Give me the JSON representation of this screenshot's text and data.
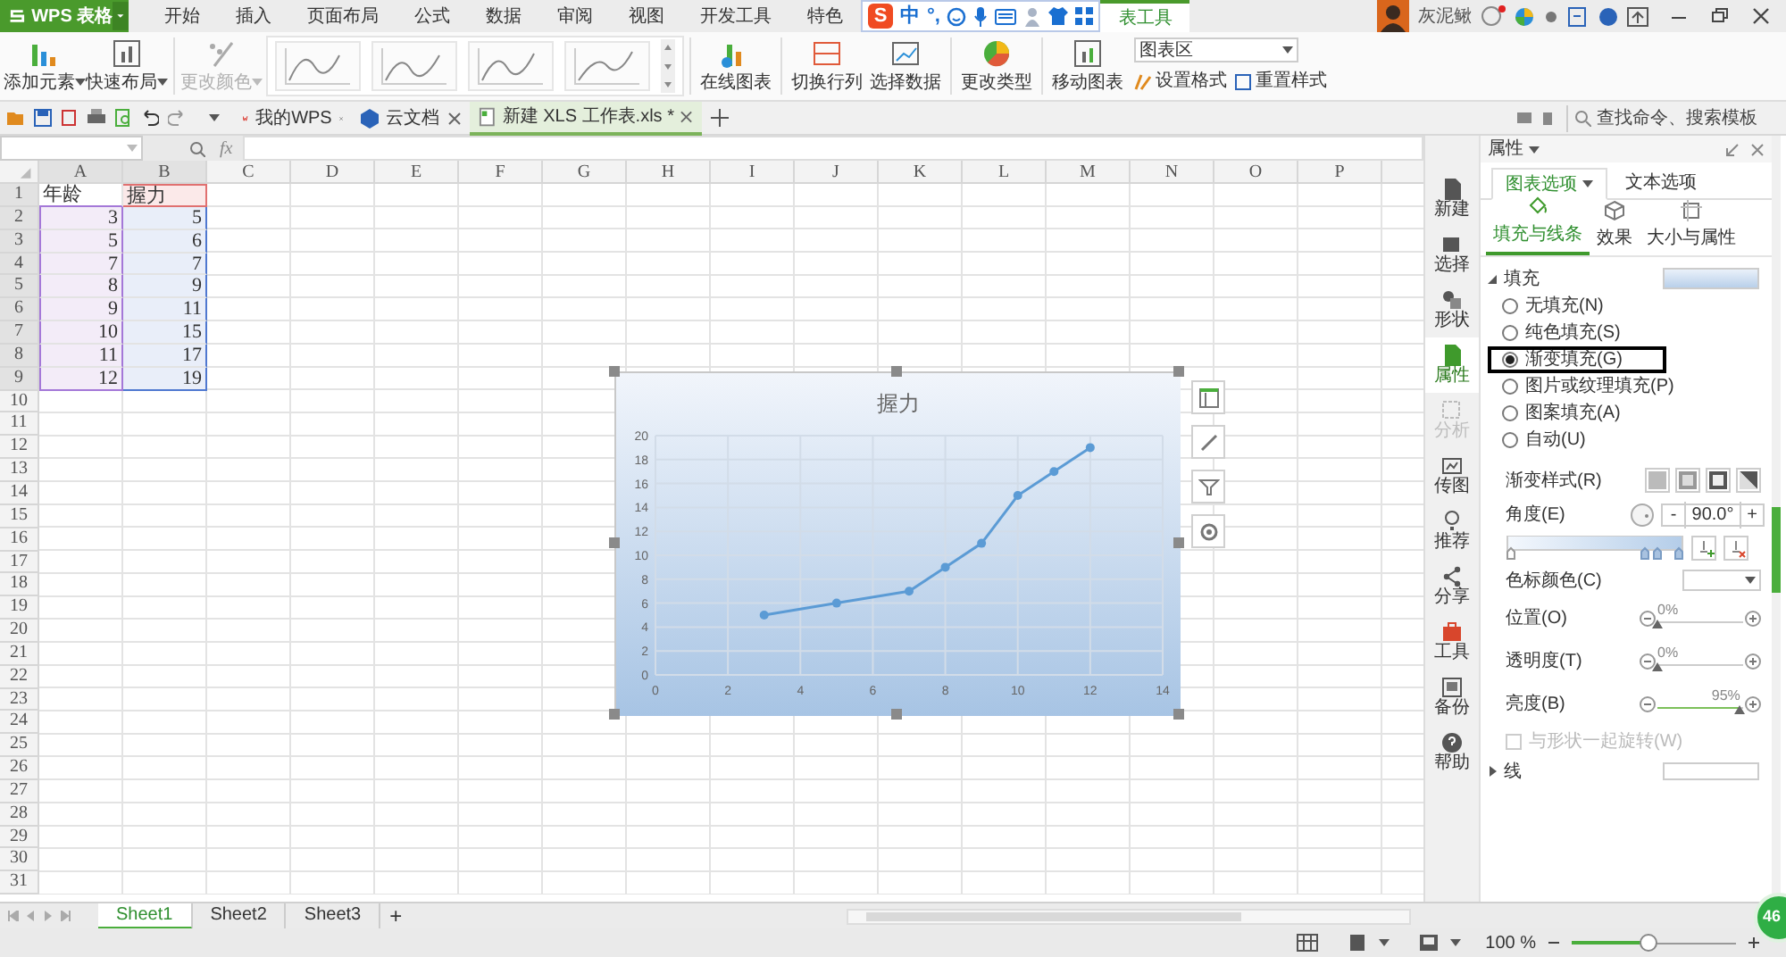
{
  "app_button": {
    "label": "WPS 表格"
  },
  "menu_tabs": [
    {
      "label": "开始",
      "selected": false
    },
    {
      "label": "插入",
      "selected": false
    },
    {
      "label": "页面布局",
      "selected": false
    },
    {
      "label": "公式",
      "selected": false
    },
    {
      "label": "数据",
      "selected": false
    },
    {
      "label": "审阅",
      "selected": false
    },
    {
      "label": "视图",
      "selected": false
    },
    {
      "label": "开发工具",
      "selected": false
    },
    {
      "label": "特色",
      "selected": false
    },
    {
      "label": "表工具",
      "selected": true
    }
  ],
  "ime_bar": {
    "logo": "S",
    "items": [
      "中",
      "°,"
    ]
  },
  "user": {
    "name": "灰泥鳅"
  },
  "ribbon": {
    "buttons_left": [
      {
        "label": "添加元素",
        "disabled": false
      },
      {
        "label": "快速布局",
        "disabled": false
      },
      {
        "label": "更改颜色",
        "disabled": true
      }
    ],
    "buttons_right": [
      {
        "label": "在线图表"
      },
      {
        "label": "切换行列"
      },
      {
        "label": "选择数据"
      },
      {
        "label": "更改类型"
      },
      {
        "label": "移动图表"
      }
    ],
    "element_select": {
      "value": "图表区"
    },
    "small_buttons": [
      {
        "label": "设置格式"
      },
      {
        "label": "重置样式"
      }
    ]
  },
  "doc_tabs": [
    {
      "label": "我的WPS",
      "selected": false
    },
    {
      "label": "云文档",
      "selected": false
    },
    {
      "label": "新建 XLS 工作表.xls *",
      "selected": true
    }
  ],
  "search": {
    "placeholder": "查找命令、搜索模板"
  },
  "formula_bar": {
    "fx": "fx"
  },
  "sheet": {
    "columns": [
      "A",
      "B",
      "C",
      "D",
      "E",
      "F",
      "G",
      "H",
      "I",
      "J",
      "K",
      "L",
      "M",
      "N",
      "O",
      "P"
    ],
    "row_numbers": [
      "1",
      "2",
      "3",
      "4",
      "5",
      "6",
      "7",
      "8",
      "9",
      "10",
      "11",
      "12",
      "13",
      "14",
      "15",
      "16",
      "17",
      "18",
      "19",
      "20",
      "21",
      "22",
      "23",
      "24",
      "25",
      "26",
      "27",
      "28",
      "29",
      "30",
      "31"
    ],
    "cells": [
      [
        "年龄",
        "握力"
      ],
      [
        "3",
        "5"
      ],
      [
        "5",
        "6"
      ],
      [
        "7",
        "7"
      ],
      [
        "8",
        "9"
      ],
      [
        "9",
        "11"
      ],
      [
        "10",
        "15"
      ],
      [
        "11",
        "17"
      ],
      [
        "12",
        "19"
      ]
    ]
  },
  "chart": {
    "selected": true,
    "chart_data": {
      "type": "line",
      "title": "握力",
      "x": [
        3,
        5,
        7,
        8,
        9,
        10,
        11,
        12
      ],
      "series": [
        {
          "color": "#5b9bd5",
          "marker": "circle",
          "values": [
            5,
            6,
            7,
            9,
            11,
            15,
            17,
            19
          ]
        }
      ],
      "grid": true,
      "xlim": [
        0,
        14
      ],
      "ylim": [
        0,
        20
      ],
      "xticks": [
        0,
        2,
        4,
        6,
        8,
        10,
        12,
        14
      ],
      "yticks": [
        0,
        2,
        4,
        6,
        8,
        10,
        12,
        14,
        16,
        18,
        20
      ]
    }
  },
  "sidebar": {
    "items": [
      {
        "label": "新建",
        "selected": false,
        "disabled": false
      },
      {
        "label": "选择",
        "selected": false,
        "disabled": false
      },
      {
        "label": "形状",
        "selected": false,
        "disabled": false
      },
      {
        "label": "属性",
        "selected": true,
        "disabled": false
      },
      {
        "label": "分析",
        "selected": false,
        "disabled": true
      },
      {
        "label": "传图",
        "selected": false,
        "disabled": false
      },
      {
        "label": "推荐",
        "selected": false,
        "disabled": false
      },
      {
        "label": "分享",
        "selected": false,
        "disabled": false
      },
      {
        "label": "工具",
        "selected": false,
        "disabled": false
      },
      {
        "label": "备份",
        "selected": false,
        "disabled": false
      },
      {
        "label": "帮助",
        "selected": false,
        "disabled": false
      }
    ]
  },
  "panel": {
    "title": "属性",
    "tabs": [
      {
        "label": "图表选项",
        "selected": true
      },
      {
        "label": "文本选项",
        "selected": false
      }
    ],
    "subtabs": [
      {
        "label": "填充与线条",
        "selected": true
      },
      {
        "label": "效果",
        "selected": false
      },
      {
        "label": "大小与属性",
        "selected": false
      }
    ],
    "fill_section": {
      "title": "填充",
      "expanded": true
    },
    "fill_options": [
      {
        "label": "无填充(N)",
        "selected": false,
        "highlighted": false
      },
      {
        "label": "纯色填充(S)",
        "selected": false,
        "highlighted": false
      },
      {
        "label": "渐变填充(G)",
        "selected": true,
        "highlighted": true
      },
      {
        "label": "图片或纹理填充(P)",
        "selected": false,
        "highlighted": false
      },
      {
        "label": "图案填充(A)",
        "selected": false,
        "highlighted": false
      },
      {
        "label": "自动(U)",
        "selected": false,
        "highlighted": false
      }
    ],
    "gradient_style": {
      "label": "渐变样式(R)"
    },
    "angle": {
      "label": "角度(E)",
      "minus": "-",
      "value": "90.0°",
      "plus": "+"
    },
    "stop_color": {
      "label": "色标颜色(C)"
    },
    "sliders": [
      {
        "label": "位置(O)",
        "reading": "0%",
        "level": 0
      },
      {
        "label": "透明度(T)",
        "reading": "0%",
        "level": 0
      },
      {
        "label": "亮度(B)",
        "reading": "95%",
        "level": 0.95
      }
    ],
    "rotate_checkbox": {
      "label": "与形状一起旋转(W)",
      "checked": false,
      "disabled": true
    },
    "line_section": {
      "title": "线",
      "expanded": false
    }
  },
  "sheet_tabs": [
    {
      "label": "Sheet1",
      "selected": true
    },
    {
      "label": "Sheet2",
      "selected": false
    },
    {
      "label": "Sheet3",
      "selected": false
    }
  ],
  "add_sheet": "+",
  "status_bar": {
    "zoom": "100 %",
    "zoom_slider": {
      "level": 0.47
    }
  },
  "float_ball": {
    "label": "46"
  }
}
